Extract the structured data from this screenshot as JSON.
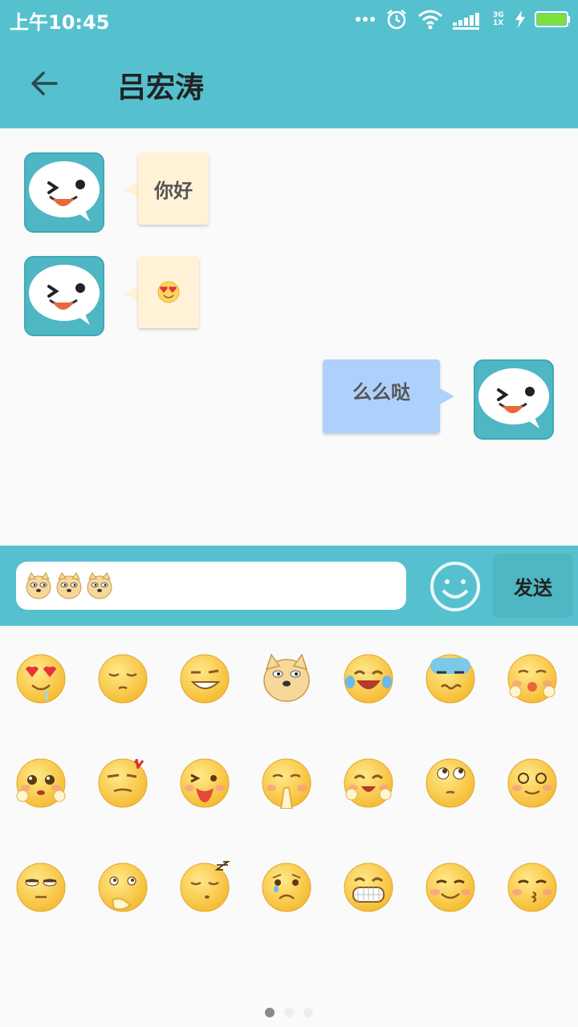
{
  "status_bar": {
    "time": "上午10:45",
    "network": "3G 1X"
  },
  "header": {
    "title": "吕宏涛"
  },
  "messages": [
    {
      "side": "left",
      "text": "你好"
    },
    {
      "side": "left",
      "emoji": "heart-eyes-emoji"
    },
    {
      "side": "right",
      "text": "么么哒"
    }
  ],
  "composer": {
    "input_emojis": [
      "doge-emoji",
      "doge-emoji",
      "doge-emoji"
    ],
    "send_label": "发送"
  },
  "emoji_grid": [
    "heart-eyes-drool",
    "sleepy-face",
    "smirk-grin",
    "doge",
    "tears-of-joy",
    "speechless-sweat",
    "shy-fist",
    "pleading-cute",
    "angry-vein",
    "wink-tongue",
    "pray-hands",
    "happy-hands",
    "eye-roll",
    "blushing-dizzy",
    "unamused",
    "thinking",
    "sleeping-zzz",
    "sad-teary",
    "big-grin",
    "smile-blush",
    "kissing"
  ],
  "pager": {
    "pages": 3,
    "active": 1
  },
  "colors": {
    "primary": "#56c1ce",
    "left_bubble": "#fff2d6",
    "right_bubble": "#aed1fb"
  }
}
